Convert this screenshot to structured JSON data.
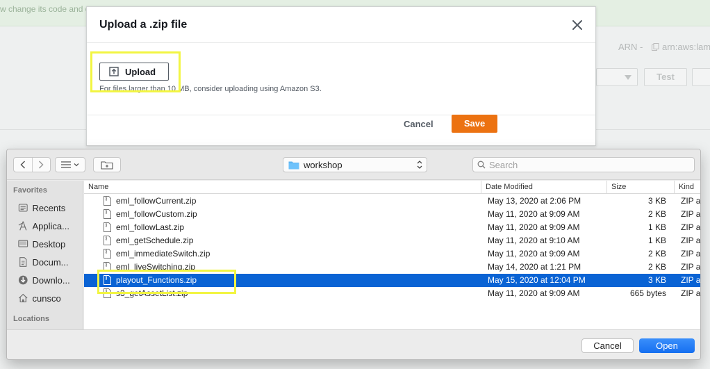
{
  "background": {
    "banner_text": "w change its code and c",
    "arn_label": "ARN -",
    "arn_value": "arn:aws:lam",
    "test_button": "Test"
  },
  "modal": {
    "title": "Upload a .zip file",
    "upload_label": "Upload",
    "hint": "For files larger than 10 MB, consider uploading using Amazon S3.",
    "cancel_label": "Cancel",
    "save_label": "Save",
    "save_color": "#ec7211"
  },
  "dialog": {
    "current_folder": "workshop",
    "search_placeholder": "Search",
    "sidebar": {
      "favorites_heading": "Favorites",
      "favorites": [
        {
          "label": "Recents",
          "icon": "clock-icon"
        },
        {
          "label": "Applica...",
          "icon": "applications-icon"
        },
        {
          "label": "Desktop",
          "icon": "desktop-icon"
        },
        {
          "label": "Docum...",
          "icon": "document-icon"
        },
        {
          "label": "Downlo...",
          "icon": "download-icon"
        },
        {
          "label": "cunsco",
          "icon": "home-icon"
        }
      ],
      "locations_heading": "Locations"
    },
    "columns": {
      "name": "Name",
      "date": "Date Modified",
      "size": "Size",
      "kind": "Kind"
    },
    "files": [
      {
        "name": "eml_followCurrent.zip",
        "date": "May 13, 2020 at 2:06 PM",
        "size": "3 KB",
        "kind": "ZIP ar"
      },
      {
        "name": "eml_followCustom.zip",
        "date": "May 11, 2020 at 9:09 AM",
        "size": "2 KB",
        "kind": "ZIP ar"
      },
      {
        "name": "eml_followLast.zip",
        "date": "May 11, 2020 at 9:09 AM",
        "size": "1 KB",
        "kind": "ZIP ar"
      },
      {
        "name": "eml_getSchedule.zip",
        "date": "May 11, 2020 at 9:10 AM",
        "size": "1 KB",
        "kind": "ZIP ar"
      },
      {
        "name": "eml_immediateSwitch.zip",
        "date": "May 11, 2020 at 9:09 AM",
        "size": "2 KB",
        "kind": "ZIP ar"
      },
      {
        "name": "eml_liveSwitching.zip",
        "date": "May 14, 2020 at 1:21 PM",
        "size": "2 KB",
        "kind": "ZIP ar"
      },
      {
        "name": "playout_Functions.zip",
        "date": "May 15, 2020 at 12:04 PM",
        "size": "3 KB",
        "kind": "ZIP ar",
        "selected": true
      },
      {
        "name": "s3_getAssetList.zip",
        "date": "May 11, 2020 at 9:09 AM",
        "size": "665 bytes",
        "kind": "ZIP ar"
      }
    ],
    "cancel_label": "Cancel",
    "open_label": "Open",
    "selection_color": "#0a63d4",
    "highlight_color": "#f2f542"
  }
}
